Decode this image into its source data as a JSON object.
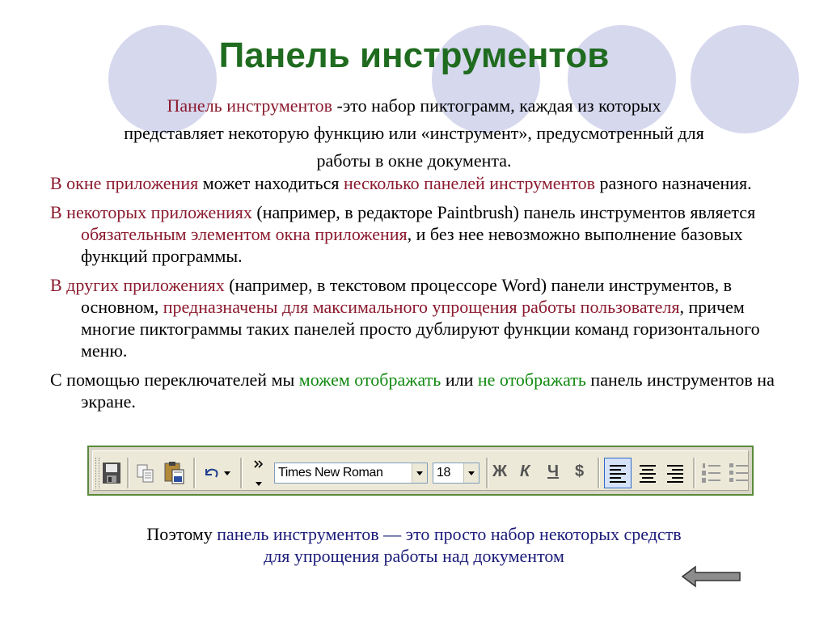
{
  "slide": {
    "title": "Панель инструментов",
    "intro": {
      "term": "Панель инструментов",
      "line1_rest": " -это набор пиктограмм, каждая из которых",
      "line2": "представляет некоторую функцию или «инструмент», предусмотренный для",
      "line3": "работы в окне документа."
    },
    "bullets": [
      {
        "a": "В окне приложения",
        "b": " может находиться ",
        "c": "несколько панелей инструментов",
        "d": " разного назначения."
      },
      {
        "a": "В некоторых приложениях",
        "b": " (например, в редакторе Paintbrush) панель инструментов является ",
        "c": "обязательным элементом окна приложения",
        "d": ", и без нее невозможно выполнение базовых функций программы."
      },
      {
        "a": "В других приложениях",
        "b": " (например, в текстовом процессоре Word) панели инструментов, в основном, ",
        "c": "предназначены для максимального упрощения работы пользователя",
        "d": ", причем многие пиктограммы таких панелей просто дублируют функции команд горизонтального меню."
      },
      {
        "a": "С помощью переключателей мы ",
        "b": "можем отображать",
        "c": " или ",
        "d": "не отображать",
        "e": " панель инструментов на экране."
      }
    ],
    "conclusion": {
      "lead": "Поэтому ",
      "rest": "панель инструментов — это просто набор некоторых средств",
      "line2": "для упрощения работы над документом"
    }
  },
  "toolbar": {
    "font_name": "Times New Roman",
    "font_size": "18",
    "bold_label": "Ж",
    "italic_label": "К",
    "underline_label": "Ч",
    "strike_label": "$",
    "icons": [
      "save-icon",
      "copy-icon",
      "paste-icon",
      "undo-icon",
      "toolbar-options-icon",
      "align-left-icon",
      "align-center-icon",
      "align-right-icon",
      "numbered-list-icon",
      "bulleted-list-icon"
    ]
  },
  "colors": {
    "title": "#1f6b1f",
    "term": "#8b1a2e",
    "highlight_green": "#128a12",
    "conclusion": "#1b1b7a",
    "circles": "#d6d8ee"
  }
}
